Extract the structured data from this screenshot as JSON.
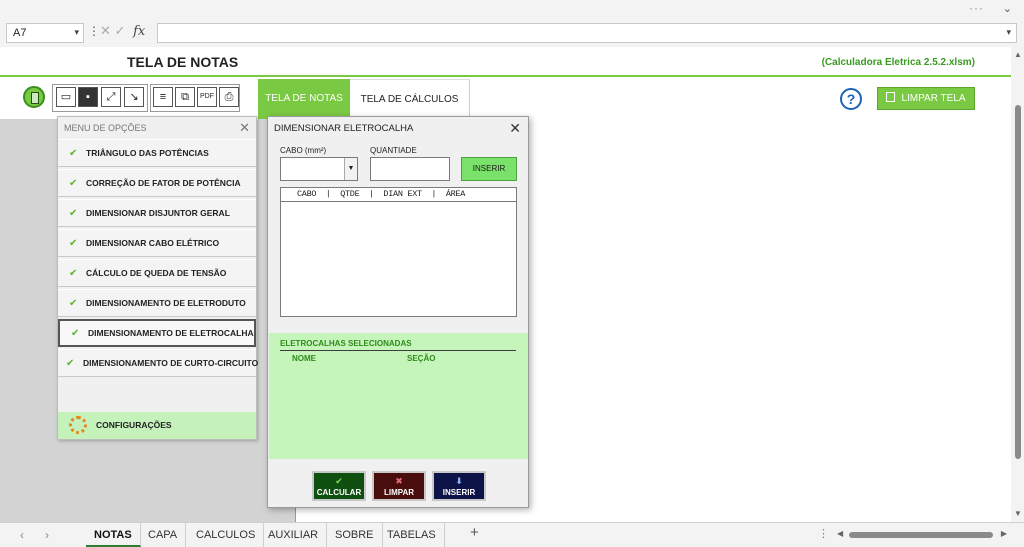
{
  "window": {
    "more_dots": "···",
    "collapse_chevron": "⌄"
  },
  "formula_bar": {
    "cell_ref": "A7",
    "fx_label": "fx",
    "cancel_glyph": "✕",
    "confirm_glyph": "✓",
    "formula_value": ""
  },
  "sheet": {
    "title": "TELA DE NOTAS",
    "file_name": "(Calculadora Eletrica 2.5.2.xlsm)",
    "tabs": [
      {
        "label": "TELA DE NOTAS",
        "active": true
      },
      {
        "label": "TELA DE CÁLCULOS",
        "active": false
      }
    ],
    "help_label": "?",
    "limpar_tela": "LIMPAR TELA",
    "icons": [
      "calculator-icon",
      "save-icon",
      "save-as-icon",
      "fullscreen-icon",
      "minimize-icon",
      "notes-icon",
      "copy-icon",
      "pdf-icon",
      "print-icon",
      "help-icon",
      "trash-icon"
    ]
  },
  "menu": {
    "title": "MENU DE OPÇÕES",
    "close": "✕",
    "items": [
      {
        "label": "TRIÂNGULO DAS POTÊNCIAS"
      },
      {
        "label": "CORREÇÃO DE FATOR DE POTÊNCIA"
      },
      {
        "label": "DIMENSIONAR DISJUNTOR GERAL"
      },
      {
        "label": "DIMENSIONAR CABO ELÉTRICO"
      },
      {
        "label": "CÁLCULO DE QUEDA DE TENSÃO"
      },
      {
        "label": "DIMENSIONAMENTO DE ELETRODUTO"
      },
      {
        "label": "DIMENSIONAMENTO DE ELETROCALHA"
      },
      {
        "label": "DIMENSIONAMENTO DE CURTO-CIRCUITO"
      }
    ],
    "config_label": "CONFIGURAÇÕES"
  },
  "dialog": {
    "title": "DIMENSIONAR ELETROCALHA",
    "close": "✕",
    "cabo_label": "CABO (mm²)",
    "cabo_value": "",
    "quantidade_label": "QUANTIADE",
    "quantidade_value": "",
    "inserir_small": "INSERIR",
    "list_header": "CABO  |  QTDE  |  DIAN EXT  |  ÁREA",
    "selected_title": "ELETROCALHAS SELECIONADAS",
    "selected_col_nome": "NOME",
    "selected_col_secao": "SEÇÃO",
    "buttons": {
      "calcular": "CALCULAR",
      "limpar": "LIMPAR",
      "inserir": "INSERIR"
    }
  },
  "sheet_tabs": [
    {
      "label": "NOTAS",
      "active": true
    },
    {
      "label": "CAPA",
      "active": false
    },
    {
      "label": "CALCULOS",
      "active": false
    },
    {
      "label": "AUXILIAR",
      "active": false
    },
    {
      "label": "SOBRE",
      "active": false
    },
    {
      "label": "TABELAS",
      "active": false
    }
  ],
  "add_sheet": "+",
  "colors": {
    "accent_green": "#7ac943",
    "file_green": "#3a9a1f",
    "panel_green": "#c5f5bb",
    "help_blue": "#1c63b8"
  }
}
